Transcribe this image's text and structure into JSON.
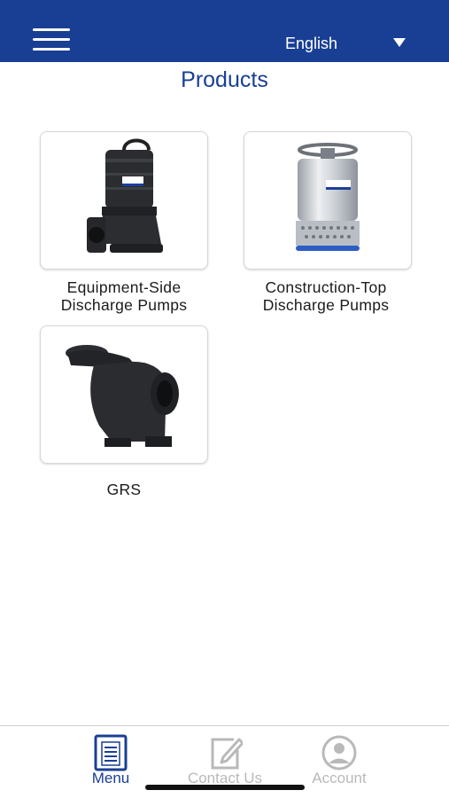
{
  "header": {
    "language_label": "English",
    "menu_icon": "hamburger-menu-icon",
    "language_icon": "dropdown-caret-icon"
  },
  "page": {
    "title": "Products"
  },
  "products": [
    {
      "caption_line1": "Equipment-Side",
      "caption_line2": "Discharge Pumps"
    },
    {
      "caption_line1": "Construction-Top",
      "caption_line2": "Discharge Pumps"
    },
    {
      "caption_line1": "GRS",
      "caption_line2": ""
    }
  ],
  "bottom_nav": {
    "tabs": [
      {
        "label": "Menu",
        "icon": "menu-document-icon",
        "active": true
      },
      {
        "label": "Contact Us",
        "icon": "edit-note-icon",
        "active": false
      },
      {
        "label": "Account",
        "icon": "user-account-icon",
        "active": false
      }
    ]
  },
  "colors": {
    "header_bg": "#193f94",
    "accent": "#193f94",
    "inactive_tab": "#b9b9b9"
  }
}
